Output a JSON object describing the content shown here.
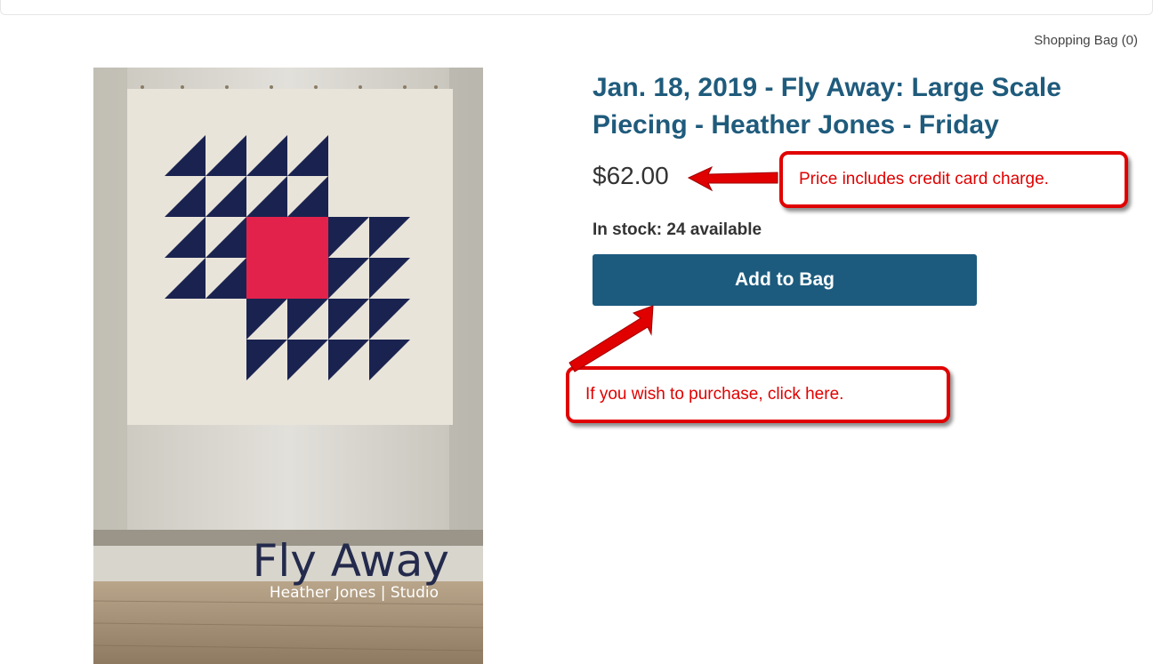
{
  "header": {
    "cart_label": "Shopping Bag (0)"
  },
  "product": {
    "image": {
      "title_text": "Fly Away",
      "subtitle_text": "Heather Jones | Studio",
      "icon": "quilt-photo"
    },
    "title": "Jan. 18, 2019 - Fly Away: Large Scale Piecing - Heather Jones - Friday",
    "price": "$62.00",
    "stock": "In stock: 24 available",
    "add_button_label": "Add to Bag"
  },
  "annotations": {
    "price_note": "Price includes credit card charge.",
    "purchase_note": "If you wish to purchase, click here."
  },
  "colors": {
    "title": "#1f5b7c",
    "button": "#1c5b7e",
    "annotation": "#e00000",
    "quilt_navy": "#1a2350",
    "quilt_red": "#e3224c"
  }
}
